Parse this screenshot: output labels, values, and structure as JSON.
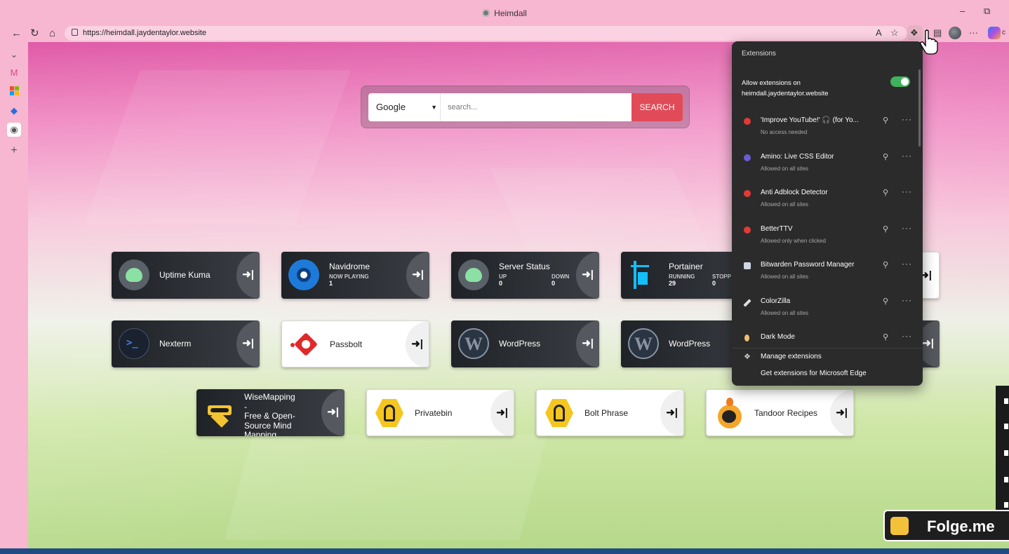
{
  "window": {
    "title": "Heimdall"
  },
  "toolbar": {
    "url": "https://heimdall.jaydentaylor.website",
    "more": "···",
    "copilot_peek": "c"
  },
  "search": {
    "provider": "Google",
    "placeholder": "search...",
    "button": "SEARCH"
  },
  "tiles": [
    {
      "name": "Uptime Kuma",
      "theme": "dark",
      "icon": "uptime-kuma-icon"
    },
    {
      "name": "Navidrome",
      "theme": "dark",
      "icon": "navidrome-icon",
      "stat_label": "NOW PLAYING",
      "stat_value": "1"
    },
    {
      "name": "Server Status",
      "theme": "dark",
      "icon": "uptime-kuma-icon",
      "up_label": "UP",
      "up_value": "0",
      "down_label": "DOWN",
      "down_value": "0"
    },
    {
      "name": "Portainer",
      "theme": "dark",
      "icon": "portainer-icon",
      "running_label": "RUNNING",
      "running_value": "29",
      "stopped_label": "STOPP",
      "stopped_value": "0"
    },
    {
      "name": "Nexterm",
      "theme": "dark",
      "icon": "nexterm-icon"
    },
    {
      "name": "Passbolt",
      "theme": "light",
      "icon": "passbolt-icon"
    },
    {
      "name": "WordPress",
      "theme": "dark",
      "icon": "wordpress-icon"
    },
    {
      "name": "WordPress",
      "theme": "dark",
      "icon": "wordpress-icon"
    },
    {
      "name": "WiseMapping - Free & Open-Source Mind Mapping",
      "lines": [
        "WiseMapping -",
        "Free & Open-",
        "Source Mind",
        "Mapping"
      ],
      "theme": "dark",
      "icon": "wisemapping-icon"
    },
    {
      "name": "Privatebin",
      "theme": "light",
      "icon": "privatebin-icon"
    },
    {
      "name": "Bolt Phrase",
      "theme": "light",
      "icon": "privatebin-icon"
    },
    {
      "name": "Tandoor Recipes",
      "theme": "light",
      "icon": "tandoor-icon"
    }
  ],
  "extensions_panel": {
    "title": "Extensions",
    "allow_line1": "Allow extensions on",
    "allow_line2": "heimdall.jaydentaylor.website",
    "allow_enabled": true,
    "items": [
      {
        "name": "'Improve YouTube!' 🎧 (for Yo...",
        "status": "No access needed",
        "color": "#e53935"
      },
      {
        "name": "Amino: Live CSS Editor",
        "status": "Allowed on all sites",
        "color": "#6b5bd6"
      },
      {
        "name": "Anti Adblock Detector",
        "status": "Allowed on all sites",
        "color": "#e53935"
      },
      {
        "name": "BetterTTV",
        "status": "Allowed only when clicked",
        "color": "#e53935"
      },
      {
        "name": "Bitwarden Password Manager",
        "status": "Allowed on all sites",
        "color": "#cfd6e6"
      },
      {
        "name": "ColorZilla",
        "status": "Allowed on all sites",
        "color": "#dddddd"
      },
      {
        "name": "Dark Mode",
        "status": "",
        "color": "#f0c070"
      }
    ],
    "manage": "Manage extensions",
    "get": "Get extensions for Microsoft Edge"
  },
  "badge": {
    "text": "Folge.me"
  }
}
